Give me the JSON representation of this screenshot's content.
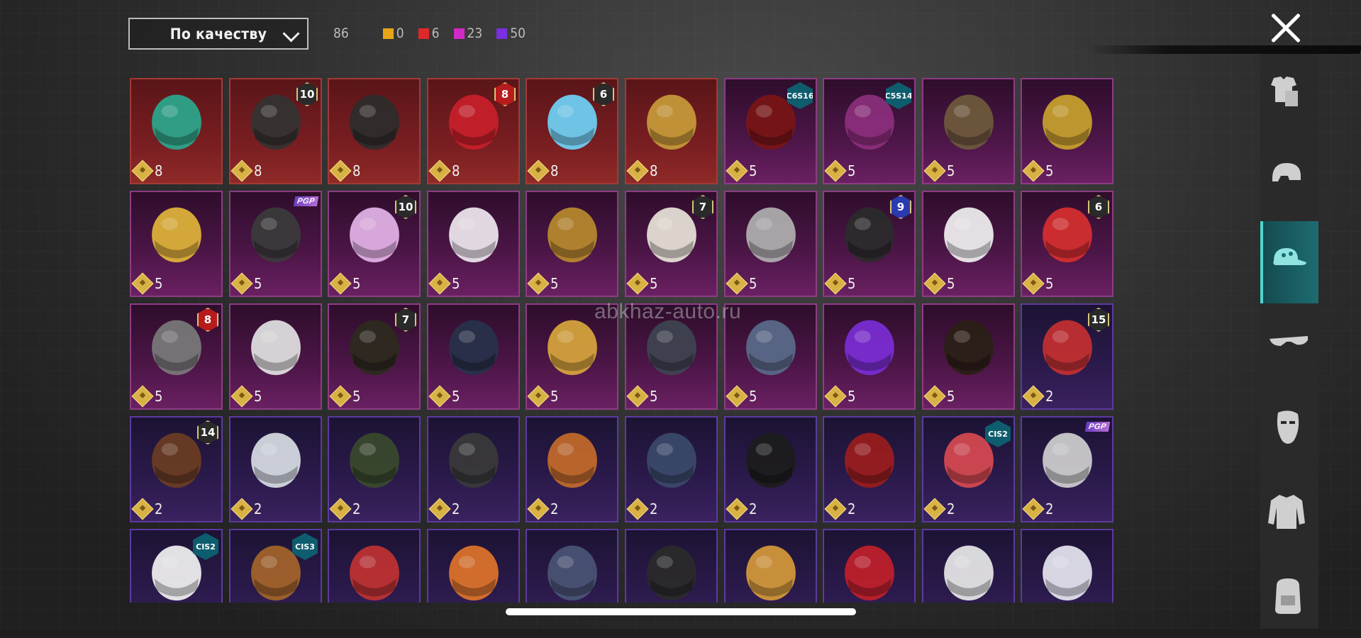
{
  "sort": {
    "label": "По качеству"
  },
  "counts": {
    "total": "86",
    "qualities": [
      {
        "color": "#e8a417",
        "value": "0"
      },
      {
        "color": "#e0282a",
        "value": "6"
      },
      {
        "color": "#d12ac8",
        "value": "23"
      },
      {
        "color": "#7a2fe0",
        "value": "50"
      }
    ]
  },
  "watermark": "abkhaz-auto.ru",
  "sidebar": {
    "tabs": [
      {
        "icon": "outfit-icon",
        "active": false
      },
      {
        "icon": "helmet-icon",
        "active": false
      },
      {
        "icon": "cap-icon",
        "active": true
      },
      {
        "icon": "glasses-icon",
        "active": false
      },
      {
        "icon": "mask-icon",
        "active": false
      },
      {
        "icon": "jacket-icon",
        "active": false
      },
      {
        "icon": "backpack-icon",
        "active": false
      }
    ]
  },
  "grid": [
    [
      {
        "q": "red",
        "price": "8",
        "badge": "",
        "item": "green-spiked-helmet",
        "c": "#2aa88d"
      },
      {
        "q": "red",
        "price": "8",
        "badge": "10",
        "item": "feathered-helmet",
        "c": "#333"
      },
      {
        "q": "red",
        "price": "8",
        "badge": "",
        "item": "dark-horned-helmet",
        "c": "#2c2c2c"
      },
      {
        "q": "red",
        "price": "8",
        "badge": "8",
        "item": "red-samurai-helmet",
        "c": "#c8202a"
      },
      {
        "q": "red",
        "price": "8",
        "badge": "6",
        "item": "ice-helmet",
        "c": "#6fd3f7"
      },
      {
        "q": "red",
        "price": "8",
        "badge": "",
        "item": "golden-claw-mask",
        "c": "#c89b3a"
      },
      {
        "q": "pink",
        "price": "5",
        "badge": "C6S16",
        "item": "red-hair",
        "c": "#7a1515"
      },
      {
        "q": "pink",
        "price": "5",
        "badge": "C5S14",
        "item": "purple-hair",
        "c": "#8c2f7d"
      },
      {
        "q": "pink",
        "price": "5",
        "badge": "",
        "item": "spiked-cage-helmet",
        "c": "#6e5a3c"
      },
      {
        "q": "pink",
        "price": "5",
        "badge": "",
        "item": "gold-purple-mask",
        "c": "#c9a22e"
      }
    ],
    [
      {
        "q": "pink",
        "price": "5",
        "badge": "",
        "item": "gold-bell-helmet",
        "c": "#e1b43a"
      },
      {
        "q": "pink",
        "price": "5",
        "badge": "PGP",
        "item": "gas-mask-hat",
        "c": "#3b3b3b"
      },
      {
        "q": "pink",
        "price": "5",
        "badge": "10",
        "item": "pink-helmet",
        "c": "#e4b4e8"
      },
      {
        "q": "pink",
        "price": "5",
        "badge": "",
        "item": "bunny-hat",
        "c": "#efe8ef"
      },
      {
        "q": "pink",
        "price": "5",
        "badge": "",
        "item": "golden-crown-hat",
        "c": "#b88a2d"
      },
      {
        "q": "pink",
        "price": "5",
        "badge": "7",
        "item": "white-crown-hood",
        "c": "#e8e4d8"
      },
      {
        "q": "pink",
        "price": "5",
        "badge": "",
        "item": "ponytail-visor",
        "c": "#b0b0b0"
      },
      {
        "q": "pink",
        "price": "5",
        "badge": "9",
        "item": "black-helmet",
        "c": "#2b2b2b"
      },
      {
        "q": "pink",
        "price": "5",
        "badge": "",
        "item": "snowman-hat",
        "c": "#f1f1f1"
      },
      {
        "q": "pink",
        "price": "5",
        "badge": "6",
        "item": "santa-mask",
        "c": "#d72f2f"
      }
    ],
    [
      {
        "q": "pink",
        "price": "5",
        "badge": "8",
        "item": "mech-helmet",
        "c": "#7a7a7a"
      },
      {
        "q": "pink",
        "price": "5",
        "badge": "",
        "item": "white-fluffy-hair",
        "c": "#e2e2e2"
      },
      {
        "q": "pink",
        "price": "5",
        "badge": "7",
        "item": "officer-cap",
        "c": "#2d2a1e"
      },
      {
        "q": "pink",
        "price": "5",
        "badge": "",
        "item": "blue-visor-helmet",
        "c": "#27324a"
      },
      {
        "q": "pink",
        "price": "5",
        "badge": "",
        "item": "golden-mask-dreads",
        "c": "#d8a63c"
      },
      {
        "q": "pink",
        "price": "5",
        "badge": "",
        "item": "tactical-helmet",
        "c": "#3e4450"
      },
      {
        "q": "pink",
        "price": "5",
        "badge": "",
        "item": "demon-mask",
        "c": "#5a6b8a"
      },
      {
        "q": "pink",
        "price": "5",
        "badge": "",
        "item": "purple-pod-helmet",
        "c": "#7b2ed6"
      },
      {
        "q": "pink",
        "price": "5",
        "badge": "",
        "item": "horn-headband",
        "c": "#2a1f16"
      },
      {
        "q": "violet",
        "price": "2",
        "badge": "15",
        "item": "pumpkin-beanie",
        "c": "#c43030"
      }
    ],
    [
      {
        "q": "violet",
        "price": "2",
        "badge": "14",
        "item": "cat-cap-hair",
        "c": "#6b3d22"
      },
      {
        "q": "violet",
        "price": "2",
        "badge": "",
        "item": "white-blue-cap",
        "c": "#d8dde4"
      },
      {
        "q": "violet",
        "price": "2",
        "badge": "",
        "item": "goggles-helmet",
        "c": "#3a4a2c"
      },
      {
        "q": "violet",
        "price": "2",
        "badge": "",
        "item": "visor-helmet",
        "c": "#3a3a3a"
      },
      {
        "q": "violet",
        "price": "2",
        "badge": "",
        "item": "orange-beanie",
        "c": "#c46b2a"
      },
      {
        "q": "violet",
        "price": "2",
        "badge": "",
        "item": "blue-beanie",
        "c": "#3b4a6a"
      },
      {
        "q": "violet",
        "price": "2",
        "badge": "",
        "item": "black-snapback",
        "c": "#1c1c1c"
      },
      {
        "q": "violet",
        "price": "2",
        "badge": "",
        "item": "bucket-hat-red-hair",
        "c": "#9b1d1d"
      },
      {
        "q": "violet",
        "price": "2",
        "badge": "CIS2",
        "item": "striped-bandana",
        "c": "#d84a50"
      },
      {
        "q": "violet",
        "price": "2",
        "badge": "PGP",
        "item": "silver-hair",
        "c": "#cfcfcf"
      }
    ],
    [
      {
        "q": "violet",
        "price": "",
        "badge": "CIS2",
        "item": "chef-hat",
        "c": "#f2f2f2"
      },
      {
        "q": "violet",
        "price": "",
        "badge": "CIS3",
        "item": "barrel-helmet",
        "c": "#a5652a"
      },
      {
        "q": "violet",
        "price": "",
        "badge": "",
        "item": "red-white-helmet",
        "c": "#c13232"
      },
      {
        "q": "violet",
        "price": "",
        "badge": "",
        "item": "orange-mask-hair",
        "c": "#e0742a"
      },
      {
        "q": "violet",
        "price": "",
        "badge": "",
        "item": "navy-cap",
        "c": "#4a5575"
      },
      {
        "q": "violet",
        "price": "",
        "badge": "",
        "item": "gas-mask",
        "c": "#2a2a2a"
      },
      {
        "q": "violet",
        "price": "",
        "badge": "",
        "item": "yellow-beanie",
        "c": "#d69a3a"
      },
      {
        "q": "violet",
        "price": "",
        "badge": "",
        "item": "british-flag-helmet",
        "c": "#c21f2a"
      },
      {
        "q": "violet",
        "price": "",
        "badge": "",
        "item": "kabuki-mask",
        "c": "#e8e8e8"
      },
      {
        "q": "violet",
        "price": "",
        "badge": "",
        "item": "white-cap",
        "c": "#e6e6f0"
      }
    ]
  ]
}
